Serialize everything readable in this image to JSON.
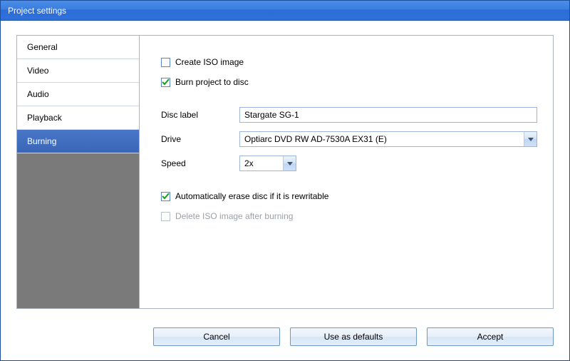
{
  "window": {
    "title": "Project settings"
  },
  "sidebar": {
    "items": [
      {
        "label": "General"
      },
      {
        "label": "Video"
      },
      {
        "label": "Audio"
      },
      {
        "label": "Playback"
      },
      {
        "label": "Burning"
      }
    ],
    "selected_index": 4
  },
  "content": {
    "create_iso": {
      "label": "Create ISO image",
      "checked": false
    },
    "burn_to_disc": {
      "label": "Burn project to disc",
      "checked": true
    },
    "disc_label": {
      "label": "Disc label",
      "value": "Stargate SG-1"
    },
    "drive": {
      "label": "Drive",
      "value": "Optiarc DVD RW AD-7530A EX31 (E)"
    },
    "speed": {
      "label": "Speed",
      "value": "2x"
    },
    "auto_erase": {
      "label": "Automatically erase disc if it is rewritable",
      "checked": true
    },
    "delete_iso": {
      "label": "Delete ISO image after burning",
      "checked": false,
      "enabled": false
    }
  },
  "buttons": {
    "cancel": "Cancel",
    "use_defaults": "Use as defaults",
    "accept": "Accept"
  }
}
